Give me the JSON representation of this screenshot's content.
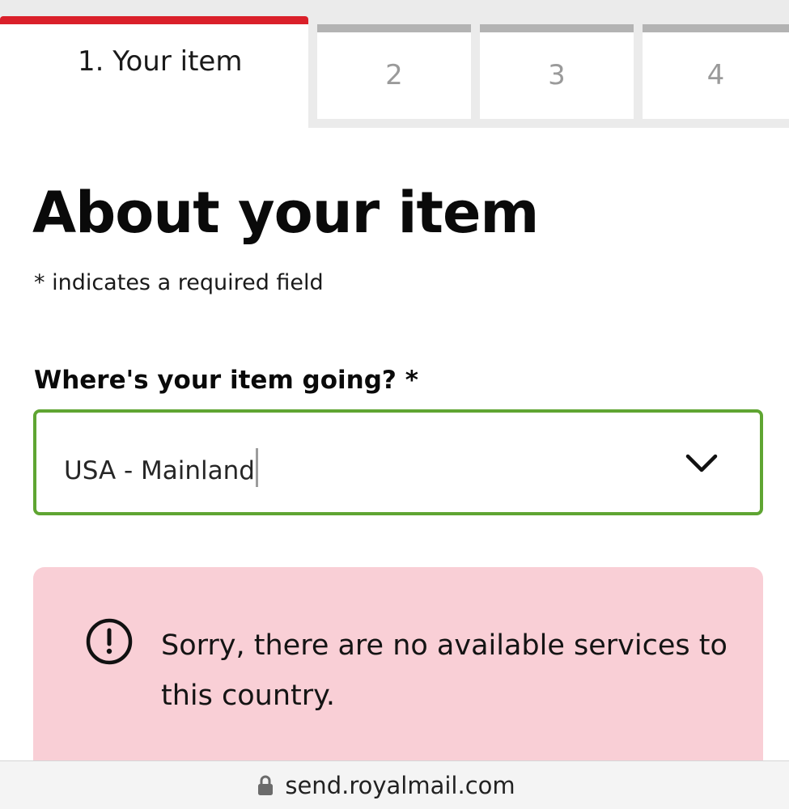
{
  "stepper": {
    "steps": [
      {
        "label": "1. Your item",
        "state": "active"
      },
      {
        "label": "2",
        "state": "inactive"
      },
      {
        "label": "3",
        "state": "inactive"
      },
      {
        "label": "4",
        "state": "inactive"
      }
    ]
  },
  "heading": {
    "title": "About your item",
    "required_note": "* indicates a required field"
  },
  "destination": {
    "label": "Where's your item going? *",
    "selected_value": "USA - Mainland",
    "icon": "chevron-down-icon"
  },
  "alert": {
    "icon": "exclamation-circle-icon",
    "message": "Sorry, there are no available services to this country."
  },
  "browser": {
    "url": "send.royalmail.com",
    "icon": "lock-icon"
  },
  "colors": {
    "active_step_accent": "#da202a",
    "inactive_step_bar": "#b3b3b3",
    "field_border_valid": "#5fa532",
    "error_background": "#f9cfd6"
  }
}
